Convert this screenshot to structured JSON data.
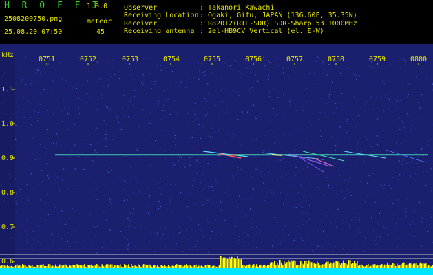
{
  "header": {
    "app_title": "H R O F F T",
    "version": "1.0.0",
    "filename": "2508200750.png",
    "meteor_label": "meteor",
    "datetime": "25.08.20 07:50",
    "meteor_count": "45",
    "info": [
      {
        "label": "Observer",
        "value": ": Takanori Kawachi"
      },
      {
        "label": "Receiving Location",
        "value": ": Ogaki, Gifu, JAPAN (136.60E, 35.35N)"
      },
      {
        "label": "Receiver",
        "value": ": R820T2(RTL-SDR) SDR-Sharp 53.1000MHz"
      },
      {
        "label": "Receiving antenna",
        "value": ": 2el-HB9CV Vertical (el. E-W)"
      }
    ]
  },
  "axes": {
    "y_unit": "kHz",
    "y_ticks": [
      "1.1",
      "1.0",
      "0.9",
      "0.8",
      "0.7",
      "0.6"
    ],
    "x_ticks": [
      "0751",
      "0752",
      "0753",
      "0754",
      "0755",
      "0756",
      "0757",
      "0758",
      "0759",
      "0800"
    ]
  },
  "colors": {
    "background": "#1a1f6e",
    "text": "#e6e600",
    "title": "#2fd12f",
    "carrier": "#3fd0a0",
    "level_bars": "#ffff00",
    "level_base": "#00e5ff"
  }
}
